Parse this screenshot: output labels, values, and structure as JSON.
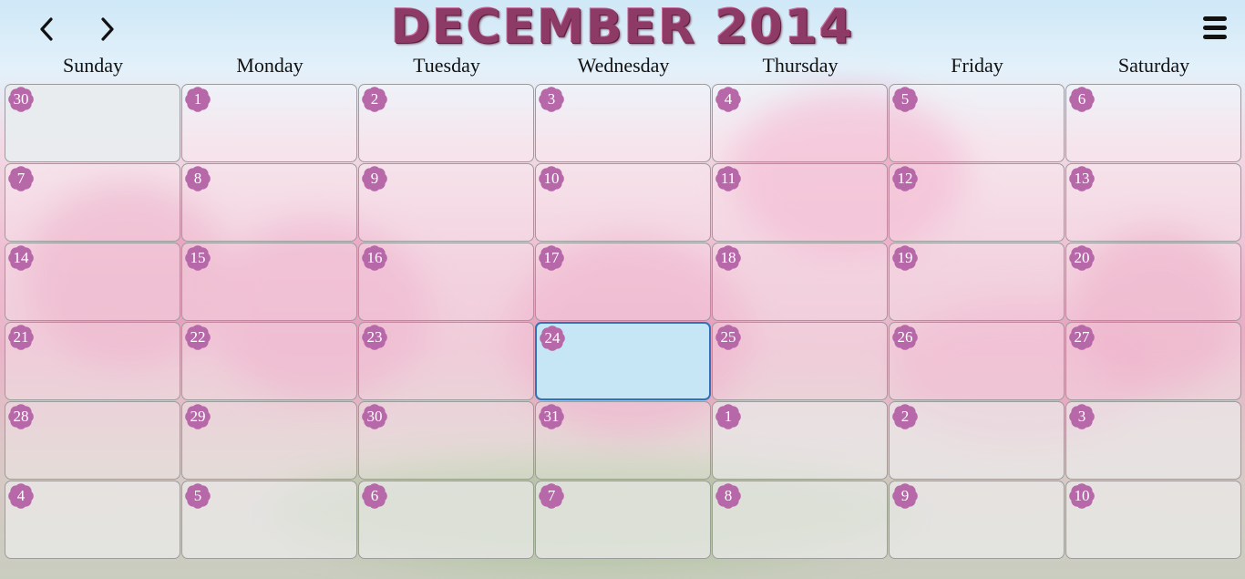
{
  "header": {
    "title": "DECEMBER 2014",
    "prev_label": "previous-month",
    "next_label": "next-month"
  },
  "weekdays": [
    "Sunday",
    "Monday",
    "Tuesday",
    "Wednesday",
    "Thursday",
    "Friday",
    "Saturday"
  ],
  "colors": {
    "flower": "#b768a8",
    "today_bg": "#c7e6f5",
    "today_border": "#2f72b8"
  },
  "weeks": [
    [
      {
        "d": "30",
        "other": true
      },
      {
        "d": "1"
      },
      {
        "d": "2"
      },
      {
        "d": "3"
      },
      {
        "d": "4"
      },
      {
        "d": "5"
      },
      {
        "d": "6"
      }
    ],
    [
      {
        "d": "7"
      },
      {
        "d": "8"
      },
      {
        "d": "9"
      },
      {
        "d": "10"
      },
      {
        "d": "11"
      },
      {
        "d": "12"
      },
      {
        "d": "13"
      }
    ],
    [
      {
        "d": "14"
      },
      {
        "d": "15"
      },
      {
        "d": "16"
      },
      {
        "d": "17"
      },
      {
        "d": "18"
      },
      {
        "d": "19"
      },
      {
        "d": "20"
      }
    ],
    [
      {
        "d": "21"
      },
      {
        "d": "22"
      },
      {
        "d": "23"
      },
      {
        "d": "24",
        "today": true
      },
      {
        "d": "25"
      },
      {
        "d": "26"
      },
      {
        "d": "27"
      }
    ],
    [
      {
        "d": "28"
      },
      {
        "d": "29"
      },
      {
        "d": "30"
      },
      {
        "d": "31"
      },
      {
        "d": "1",
        "other": true
      },
      {
        "d": "2",
        "other": true
      },
      {
        "d": "3",
        "other": true
      }
    ],
    [
      {
        "d": "4",
        "other": true
      },
      {
        "d": "5",
        "other": true
      },
      {
        "d": "6",
        "other": true
      },
      {
        "d": "7",
        "other": true
      },
      {
        "d": "8",
        "other": true
      },
      {
        "d": "9",
        "other": true
      },
      {
        "d": "10",
        "other": true
      }
    ]
  ]
}
